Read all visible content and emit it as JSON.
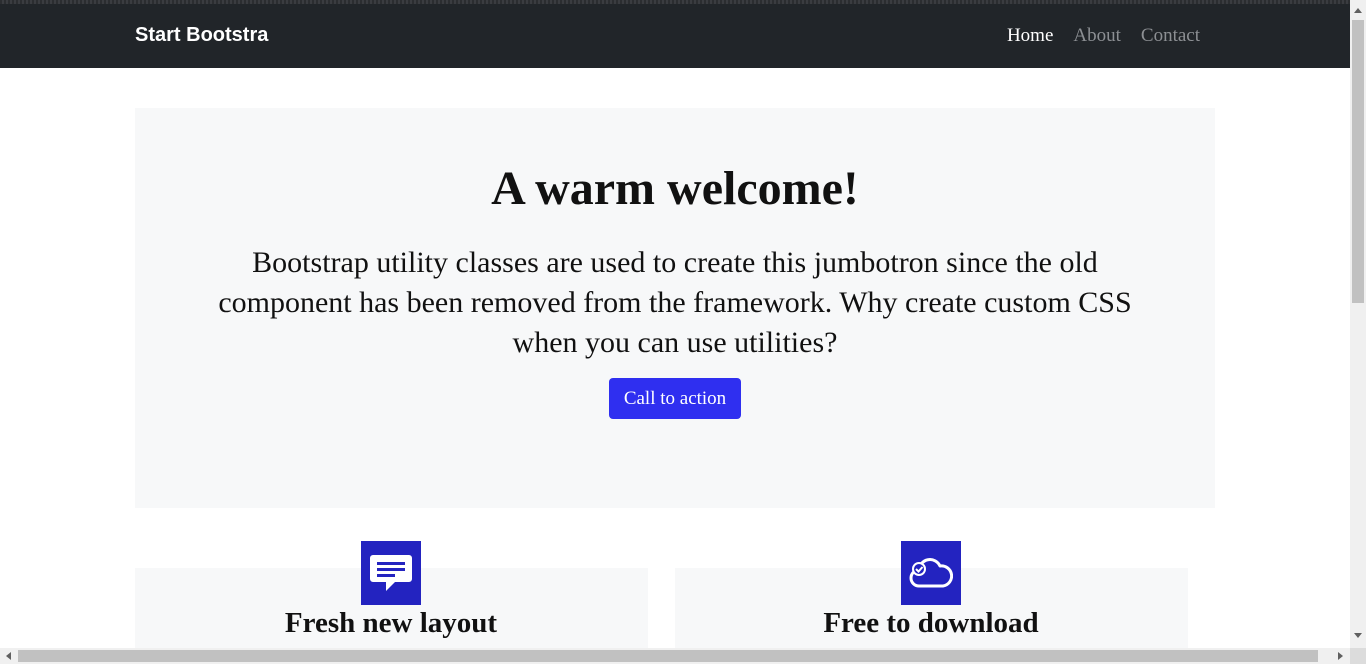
{
  "navbar": {
    "brand": "Start Bootstra",
    "links": [
      {
        "label": "Home",
        "active": true
      },
      {
        "label": "About",
        "active": false
      },
      {
        "label": "Contact",
        "active": false
      }
    ]
  },
  "hero": {
    "title": "A warm welcome!",
    "text": "Bootstrap utility classes are used to create this jumbotron since the old component has been removed from the framework. Why create custom CSS when you can use utilities?",
    "cta_label": "Call to action"
  },
  "features": [
    {
      "icon": "chat-square-text-icon",
      "title": "Fresh new layout"
    },
    {
      "icon": "cloud-check-icon",
      "title": "Free to download"
    }
  ],
  "colors": {
    "navbar_bg": "#212529",
    "accent": "#2f2ff0",
    "icon_bg": "#2323c0",
    "panel_bg": "#f7f8f9"
  },
  "scrollbars": {
    "vertical_position": 0,
    "horizontal_position": 0
  }
}
